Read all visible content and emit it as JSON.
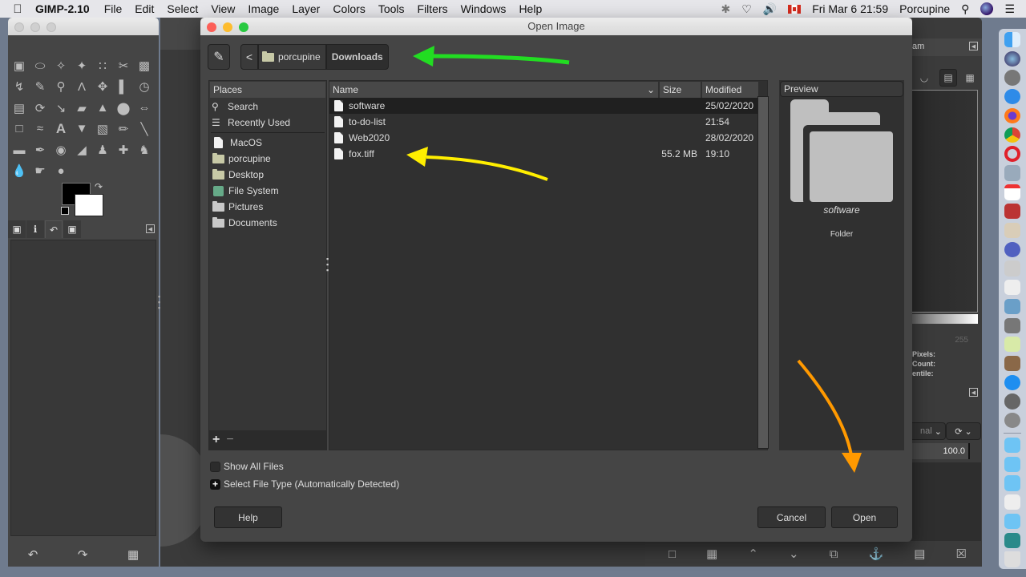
{
  "menubar": {
    "app_name": "GIMP-2.10",
    "menus": [
      "File",
      "Edit",
      "Select",
      "View",
      "Image",
      "Layer",
      "Colors",
      "Tools",
      "Filters",
      "Windows",
      "Help"
    ],
    "clock": "Fri Mar 6  21:59",
    "user": "Porcupine",
    "status_icons": [
      "bluetooth-icon",
      "wifi-icon",
      "volume-icon",
      "canada-flag-icon",
      "search-icon",
      "siri-icon",
      "notification-list-icon"
    ]
  },
  "dialog": {
    "title": "Open Image",
    "path_bar": {
      "back_label": "<",
      "segments": [
        "porcupine",
        "Downloads"
      ],
      "current": "Downloads"
    },
    "places": {
      "header": "Places",
      "top_items": [
        {
          "label": "Search",
          "icon": "search-icon"
        },
        {
          "label": "Recently Used",
          "icon": "recent-icon"
        }
      ],
      "items": [
        {
          "label": "MacOS",
          "icon": "file-icon"
        },
        {
          "label": "porcupine",
          "icon": "folder-icon"
        },
        {
          "label": "Desktop",
          "icon": "folder-icon"
        },
        {
          "label": "File System",
          "icon": "filesystem-icon"
        },
        {
          "label": "Pictures",
          "icon": "folder-icon"
        },
        {
          "label": "Documents",
          "icon": "folder-icon"
        }
      ],
      "add_label": "+",
      "remove_label": "−"
    },
    "file_list": {
      "columns": {
        "name": "Name",
        "size": "Size",
        "modified": "Modified"
      },
      "rows": [
        {
          "name": "software",
          "size": "",
          "modified": "25/02/2020",
          "selected": true
        },
        {
          "name": "to-do-list",
          "size": "",
          "modified": "21:54",
          "selected": false
        },
        {
          "name": "Web2020",
          "size": "",
          "modified": "28/02/2020",
          "selected": false
        },
        {
          "name": "fox.tiff",
          "size": "55.2 MB",
          "modified": "19:10",
          "selected": false
        }
      ]
    },
    "preview": {
      "header": "Preview",
      "name": "software",
      "type": "Folder"
    },
    "show_all_files": {
      "label": "Show All Files",
      "checked": false
    },
    "select_file_type": {
      "label": "Select File Type (Automatically Detected)",
      "expanded": false
    },
    "buttons": {
      "help": "Help",
      "cancel": "Cancel",
      "open": "Open"
    }
  },
  "right_panel": {
    "tab_label": "am",
    "histogram": {
      "max_value": "255",
      "stats": [
        "Pixels:",
        "Count:",
        "entile:"
      ]
    },
    "mode_label": "nal",
    "opacity": "100.0"
  },
  "annotations": {
    "green_arrow_color": "#22dd22",
    "yellow_arrow_color": "#ffee00",
    "orange_arrow_color": "#ff9900"
  }
}
